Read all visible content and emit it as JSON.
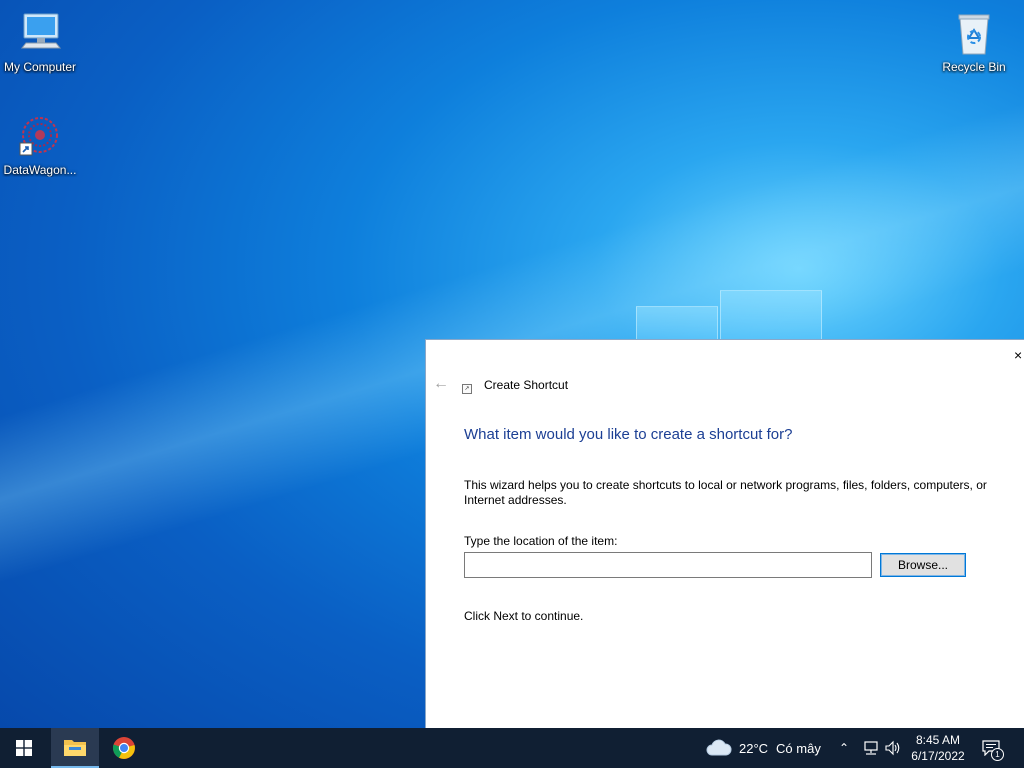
{
  "desktop": {
    "icons": [
      {
        "label": "My Computer",
        "icon": "computer-icon"
      },
      {
        "label": "DataWagon...",
        "icon": "datawagon-shortcut-icon"
      },
      {
        "label": "Recycle Bin",
        "icon": "recycle-bin-icon"
      }
    ]
  },
  "dialog": {
    "title": "Create Shortcut",
    "heading": "What item would you like to create a shortcut for?",
    "description": "This wizard helps you to create shortcuts to local or network programs, files, folders, computers, or Internet addresses.",
    "location_label": "Type the location of the item:",
    "location_value": "",
    "browse_label": "Browse...",
    "next_hint": "Click Next to continue.",
    "close_glyph": "×",
    "back_glyph": "←"
  },
  "taskbar": {
    "apps": [
      {
        "name": "File Explorer",
        "icon": "file-explorer-icon",
        "active": true
      },
      {
        "name": "Google Chrome",
        "icon": "chrome-icon",
        "active": false
      }
    ],
    "weather": {
      "temp": "22°C",
      "condition": "Có mây"
    },
    "clock": {
      "time": "8:45 AM",
      "date": "6/17/2022"
    },
    "notification_count": "1"
  },
  "colors": {
    "heading": "#1c3f94",
    "taskbar": "#101f33",
    "accent": "#0078d7"
  }
}
